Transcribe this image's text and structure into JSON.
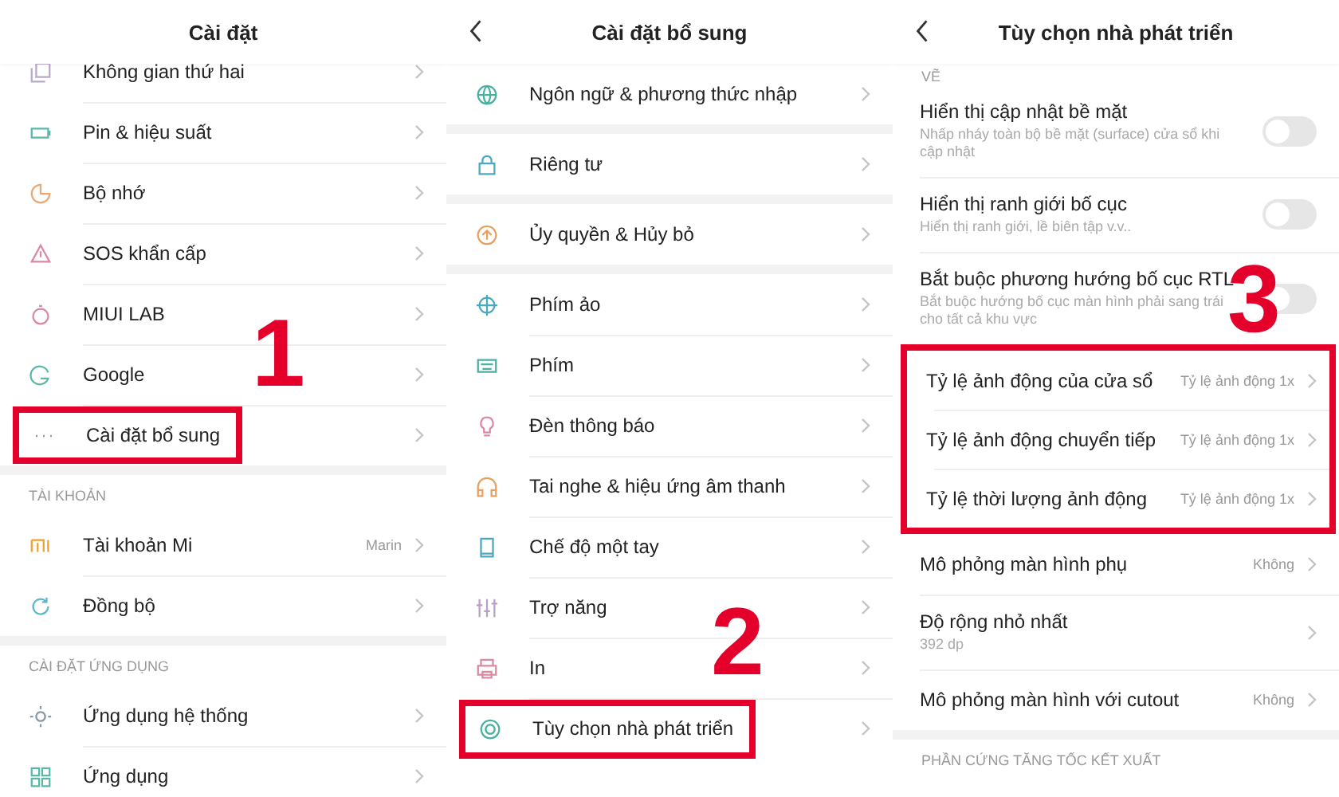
{
  "panels": [
    {
      "title": "Cài đặt",
      "back": false,
      "step": "1",
      "blocks": [
        {
          "kind": "rows",
          "boxed": false,
          "rows": [
            {
              "kind": "link",
              "label": "Không gian thứ hai",
              "highlighted": false
            },
            {
              "kind": "link",
              "label": "Pin & hiệu suất",
              "highlighted": false
            },
            {
              "kind": "link",
              "label": "Bộ nhớ",
              "highlighted": false
            },
            {
              "kind": "link",
              "label": "SOS khẩn cấp",
              "highlighted": false
            },
            {
              "kind": "link",
              "label": "MIUI LAB",
              "highlighted": false
            },
            {
              "kind": "link",
              "label": "Google",
              "highlighted": false
            },
            {
              "kind": "link",
              "label": "Cài đặt bổ sung",
              "highlighted": true
            }
          ]
        },
        {
          "kind": "gap"
        },
        {
          "kind": "header",
          "text": "TÀI KHOẢN"
        },
        {
          "kind": "rows",
          "boxed": false,
          "rows": [
            {
              "kind": "link",
              "label": "Tài khoản Mi",
              "value": "Marin",
              "highlighted": false
            },
            {
              "kind": "link",
              "label": "Đồng bộ",
              "highlighted": false
            }
          ]
        },
        {
          "kind": "gap"
        },
        {
          "kind": "header",
          "text": "CÀI ĐẶT ỨNG DỤNG"
        },
        {
          "kind": "rows",
          "boxed": false,
          "rows": [
            {
              "kind": "link",
              "label": "Ứng dụng hệ thống",
              "highlighted": false
            },
            {
              "kind": "link",
              "label": "Ứng dụng",
              "highlighted": false
            }
          ]
        }
      ]
    },
    {
      "title": "Cài đặt bổ sung",
      "back": true,
      "step": "2",
      "blocks": [
        {
          "kind": "rows",
          "boxed": false,
          "rows": [
            {
              "kind": "link",
              "label": "Ngôn ngữ & phương thức nhập",
              "highlighted": false
            }
          ]
        },
        {
          "kind": "gap"
        },
        {
          "kind": "rows",
          "boxed": false,
          "rows": [
            {
              "kind": "link",
              "label": "Riêng tư",
              "highlighted": false
            }
          ]
        },
        {
          "kind": "gap"
        },
        {
          "kind": "rows",
          "boxed": false,
          "rows": [
            {
              "kind": "link",
              "label": "Ủy quyền & Hủy bỏ",
              "highlighted": false
            }
          ]
        },
        {
          "kind": "gap"
        },
        {
          "kind": "rows",
          "boxed": false,
          "rows": [
            {
              "kind": "link",
              "label": "Phím ảo",
              "highlighted": false
            },
            {
              "kind": "link",
              "label": "Phím",
              "highlighted": false
            },
            {
              "kind": "link",
              "label": "Đèn thông báo",
              "highlighted": false
            },
            {
              "kind": "link",
              "label": "Tai nghe & hiệu ứng âm thanh",
              "highlighted": false
            },
            {
              "kind": "link",
              "label": "Chế độ một tay",
              "highlighted": false
            },
            {
              "kind": "link",
              "label": "Trợ năng",
              "highlighted": false
            },
            {
              "kind": "link",
              "label": "In",
              "highlighted": false
            },
            {
              "kind": "link",
              "label": "Tùy chọn nhà phát triển",
              "highlighted": true
            }
          ]
        }
      ]
    },
    {
      "title": "Tùy chọn nhà phát triển",
      "back": true,
      "step": "3",
      "blocks": [
        {
          "kind": "header",
          "text": "VẼ"
        },
        {
          "kind": "rows",
          "boxed": false,
          "rows": [
            {
              "kind": "toggle",
              "label": "Hiển thị cập nhật bề mặt",
              "subtitle": "Nhấp nháy toàn bộ bề mặt (surface) cửa sổ khi cập nhật",
              "on": false
            },
            {
              "kind": "toggle",
              "label": "Hiển thị ranh giới bố cục",
              "subtitle": "Hiển thị ranh giới, lề biên tập v.v..",
              "on": false
            },
            {
              "kind": "toggle",
              "label": "Bắt buộc phương hướng bố cục RTL",
              "subtitle": "Bắt buộc hướng bố cục màn hình phải sang trái cho tất cả khu vực",
              "on": false
            }
          ]
        },
        {
          "kind": "rows",
          "boxed": true,
          "rows": [
            {
              "kind": "link",
              "label": "Tỷ lệ ảnh động của cửa sổ",
              "value": "Tỷ lệ ảnh động 1x"
            },
            {
              "kind": "link",
              "label": "Tỷ lệ ảnh động chuyển tiếp",
              "value": "Tỷ lệ ảnh động 1x"
            },
            {
              "kind": "link",
              "label": "Tỷ lệ thời lượng ảnh động",
              "value": "Tỷ lệ ảnh động 1x"
            }
          ]
        },
        {
          "kind": "rows",
          "boxed": false,
          "rows": [
            {
              "kind": "link",
              "label": "Mô phỏng màn hình phụ",
              "value": "Không"
            },
            {
              "kind": "link",
              "label": "Độ rộng nhỏ nhất",
              "subtitle": "392 dp"
            },
            {
              "kind": "link",
              "label": "Mô phỏng màn hình với cutout",
              "value": "Không"
            }
          ]
        },
        {
          "kind": "gap"
        },
        {
          "kind": "header",
          "text": "PHẦN CỨNG TĂNG TỐC KẾT XUẤT"
        }
      ]
    }
  ]
}
